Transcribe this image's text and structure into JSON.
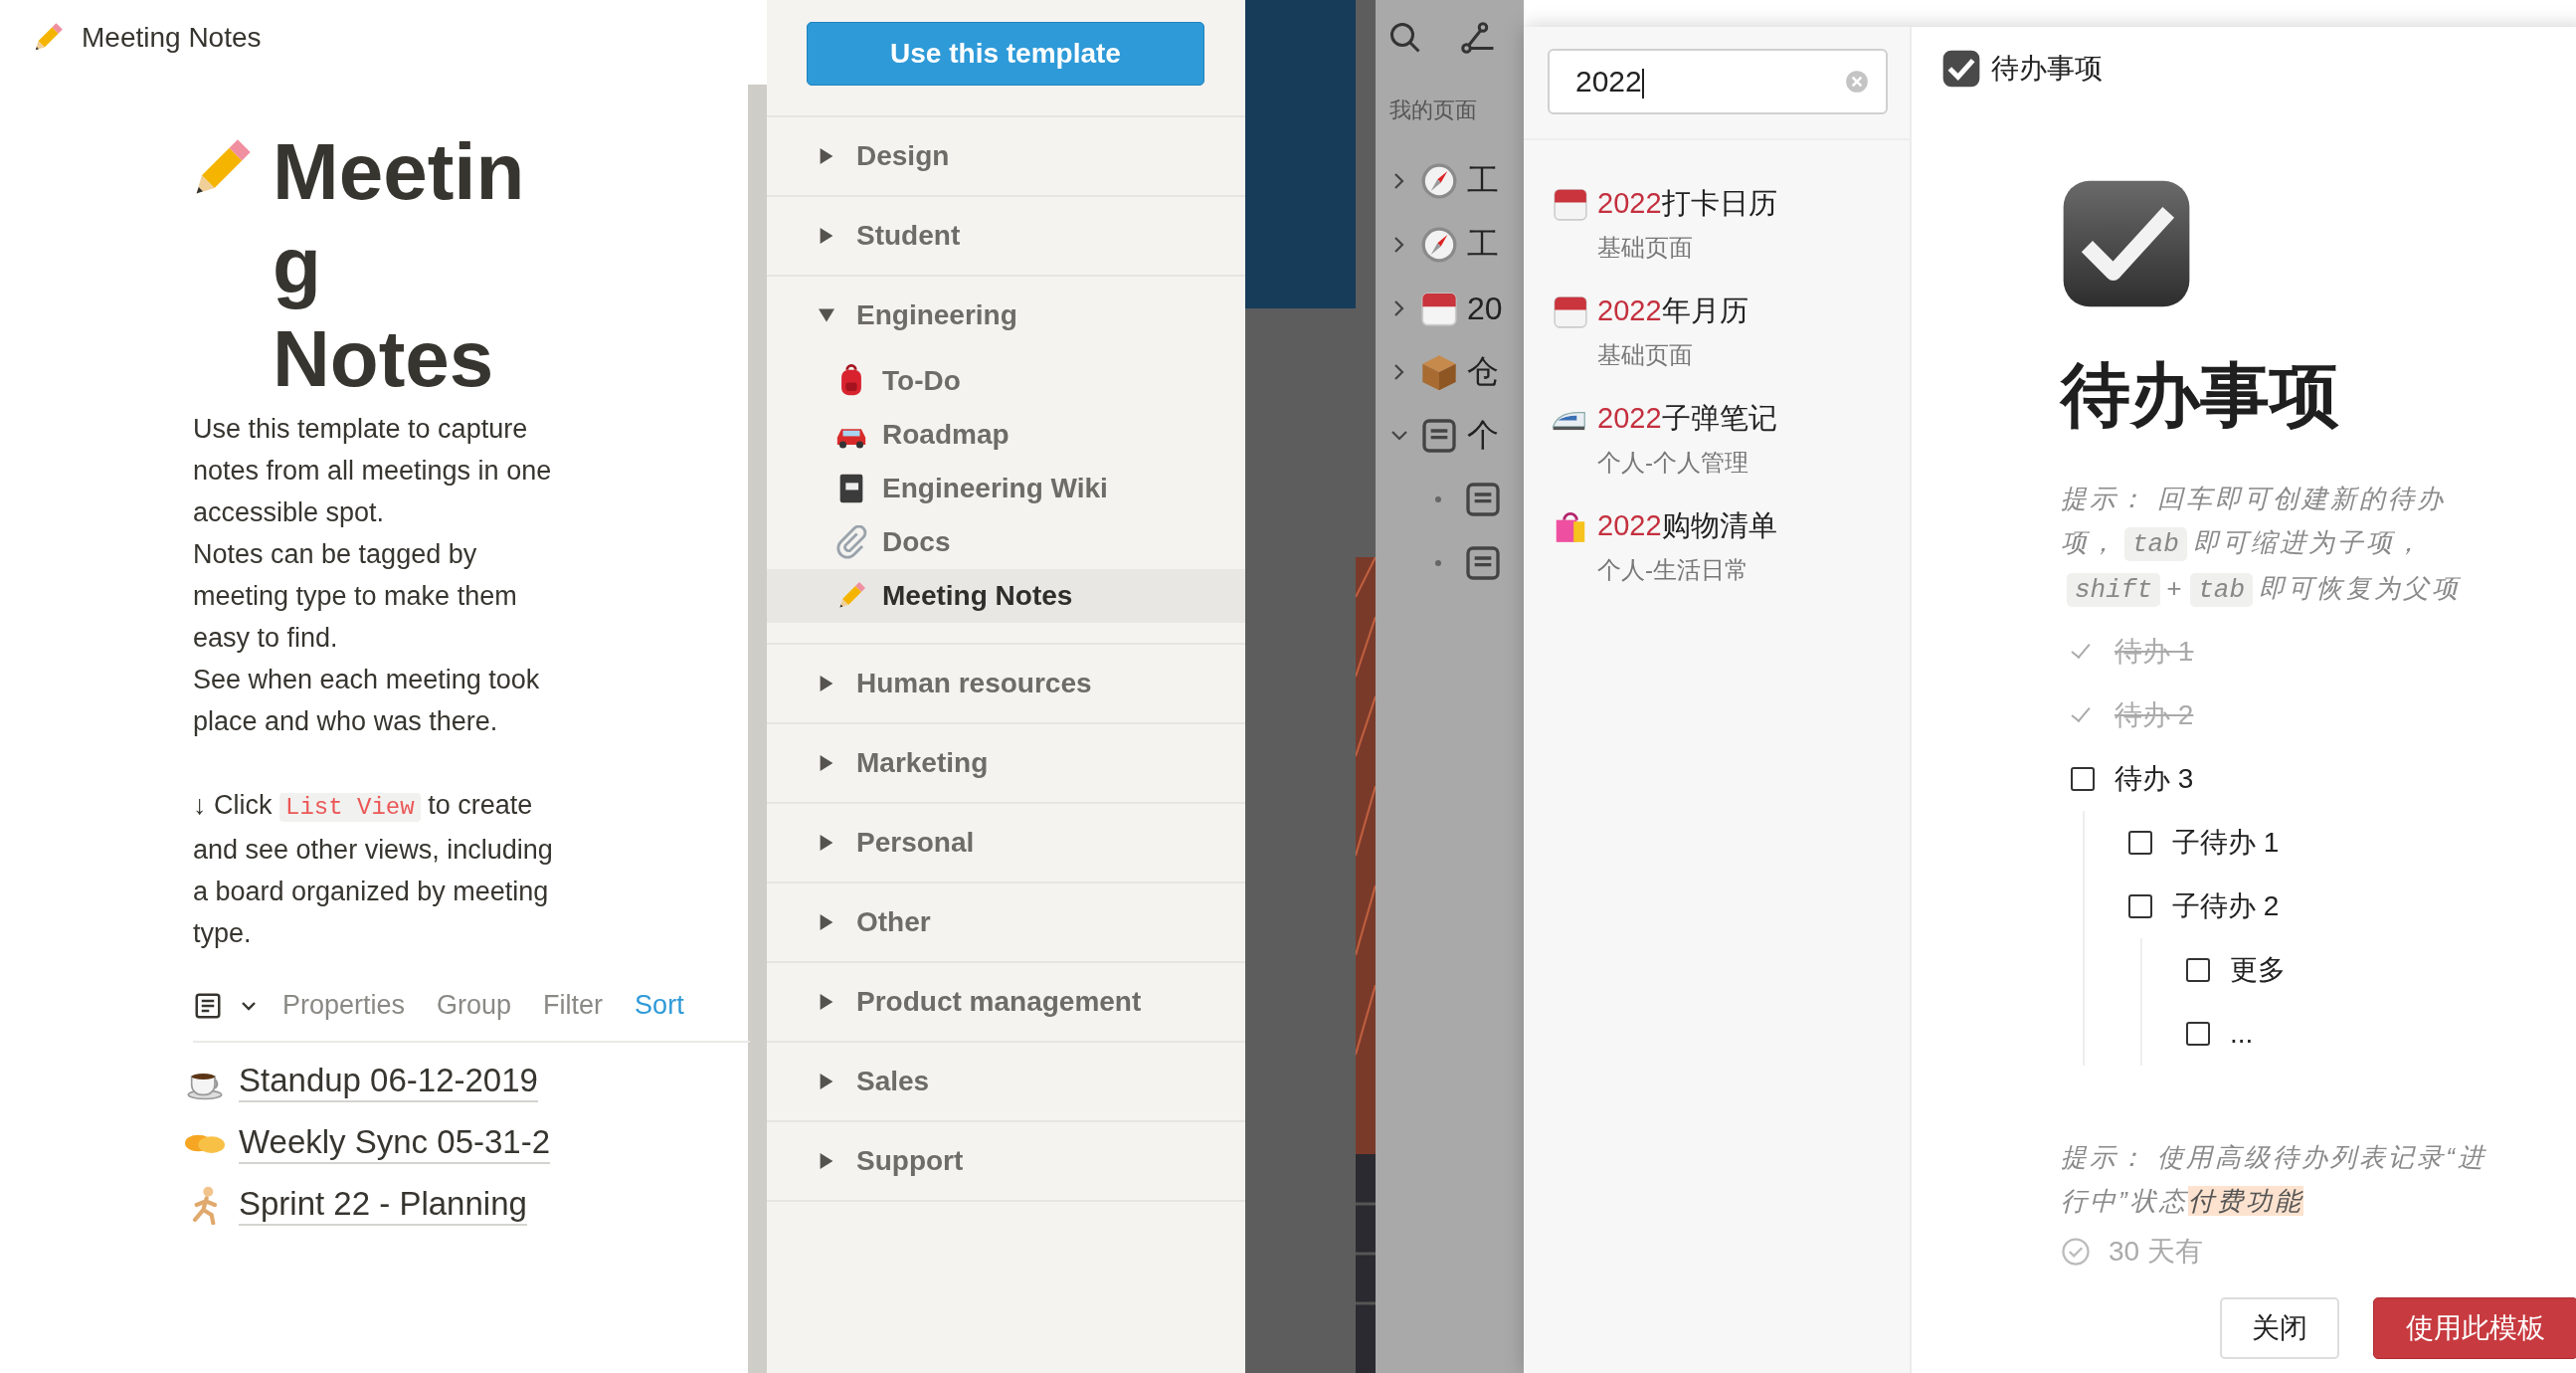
{
  "left_page": {
    "breadcrumb": "Meeting Notes",
    "title": "Meeting Notes",
    "description": [
      "Use this template to capture notes from all meetings in one accessible spot.",
      "Notes can be tagged by meeting type to make them easy to find.",
      "See when each meeting took place and who was there."
    ],
    "hint": {
      "before": "↓ Click",
      "code": "List View",
      "after": "to create and see other views, including a board organized by meeting type."
    },
    "toolbar": [
      {
        "label": "Properties",
        "selected": false
      },
      {
        "label": "Group",
        "selected": false
      },
      {
        "label": "Filter",
        "selected": false
      },
      {
        "label": "Sort",
        "selected": true
      }
    ],
    "entries": [
      "Standup 06-12-2019",
      "Weekly Sync 05-31-2",
      "Sprint 22 - Planning"
    ]
  },
  "template_gallery": {
    "button": "Use this template",
    "categories": [
      {
        "label": "Design",
        "expanded": false
      },
      {
        "label": "Student",
        "expanded": false
      },
      {
        "label": "Engineering",
        "expanded": true,
        "children": [
          {
            "label": "To-Do",
            "selected": false
          },
          {
            "label": "Roadmap",
            "selected": false
          },
          {
            "label": "Engineering Wiki",
            "selected": false
          },
          {
            "label": "Docs",
            "selected": false
          },
          {
            "label": "Meeting Notes",
            "selected": true
          }
        ]
      },
      {
        "label": "Human resources",
        "expanded": false
      },
      {
        "label": "Marketing",
        "expanded": false
      },
      {
        "label": "Personal",
        "expanded": false
      },
      {
        "label": "Other",
        "expanded": false
      },
      {
        "label": "Product management",
        "expanded": false
      },
      {
        "label": "Sales",
        "expanded": false
      },
      {
        "label": "Support",
        "expanded": false
      }
    ]
  },
  "background_sidebar": {
    "heading": "我的页面",
    "items": [
      {
        "text": "工",
        "expanded": false
      },
      {
        "text": "工",
        "expanded": false
      },
      {
        "text": "20",
        "expanded": false
      },
      {
        "text": "仓",
        "expanded": false
      },
      {
        "text": "个",
        "expanded": true
      }
    ]
  },
  "search": {
    "value": "2022",
    "results": [
      {
        "match": "2022",
        "rest": "打卡日历",
        "subtitle": "基础页面"
      },
      {
        "match": "2022",
        "rest": "年月历",
        "subtitle": "基础页面"
      },
      {
        "match": "2022",
        "rest": "子弹笔记",
        "subtitle": "个人-个人管理"
      },
      {
        "match": "2022",
        "rest": "购物清单",
        "subtitle": "个人-生活日常"
      }
    ]
  },
  "preview": {
    "header": "待办事项",
    "title": "待办事项",
    "tip": [
      {
        "kind": "text",
        "text": "提示： 回车即可创建新的待办项，"
      },
      {
        "kind": "code",
        "text": "tab"
      },
      {
        "kind": "text",
        "text": "即可缩进为子项，"
      },
      {
        "kind": "code",
        "text": "shift"
      },
      {
        "kind": "text",
        "text": "+"
      },
      {
        "kind": "code",
        "text": "tab"
      },
      {
        "kind": "text",
        "text": "即可恢复为父项"
      }
    ],
    "todos": [
      {
        "text": "待办 1",
        "checked": true
      },
      {
        "text": "待办 2",
        "checked": true
      },
      {
        "text": "待办 3",
        "checked": false,
        "children": [
          {
            "text": "子待办 1",
            "checked": false
          },
          {
            "text": "子待办 2",
            "checked": false,
            "children": [
              {
                "text": "更多",
                "checked": false
              },
              {
                "text": "...",
                "checked": false
              }
            ]
          }
        ]
      }
    ],
    "tip2": [
      {
        "kind": "text",
        "text": "提示： 使用高级待办列表记录“进行中”状态"
      },
      {
        "kind": "highlight",
        "text": "付费功能"
      }
    ],
    "extra_item": "30 天有",
    "buttons": [
      {
        "label": "关闭",
        "kind": "secondary"
      },
      {
        "label": "使用此模板",
        "kind": "primary"
      }
    ]
  }
}
